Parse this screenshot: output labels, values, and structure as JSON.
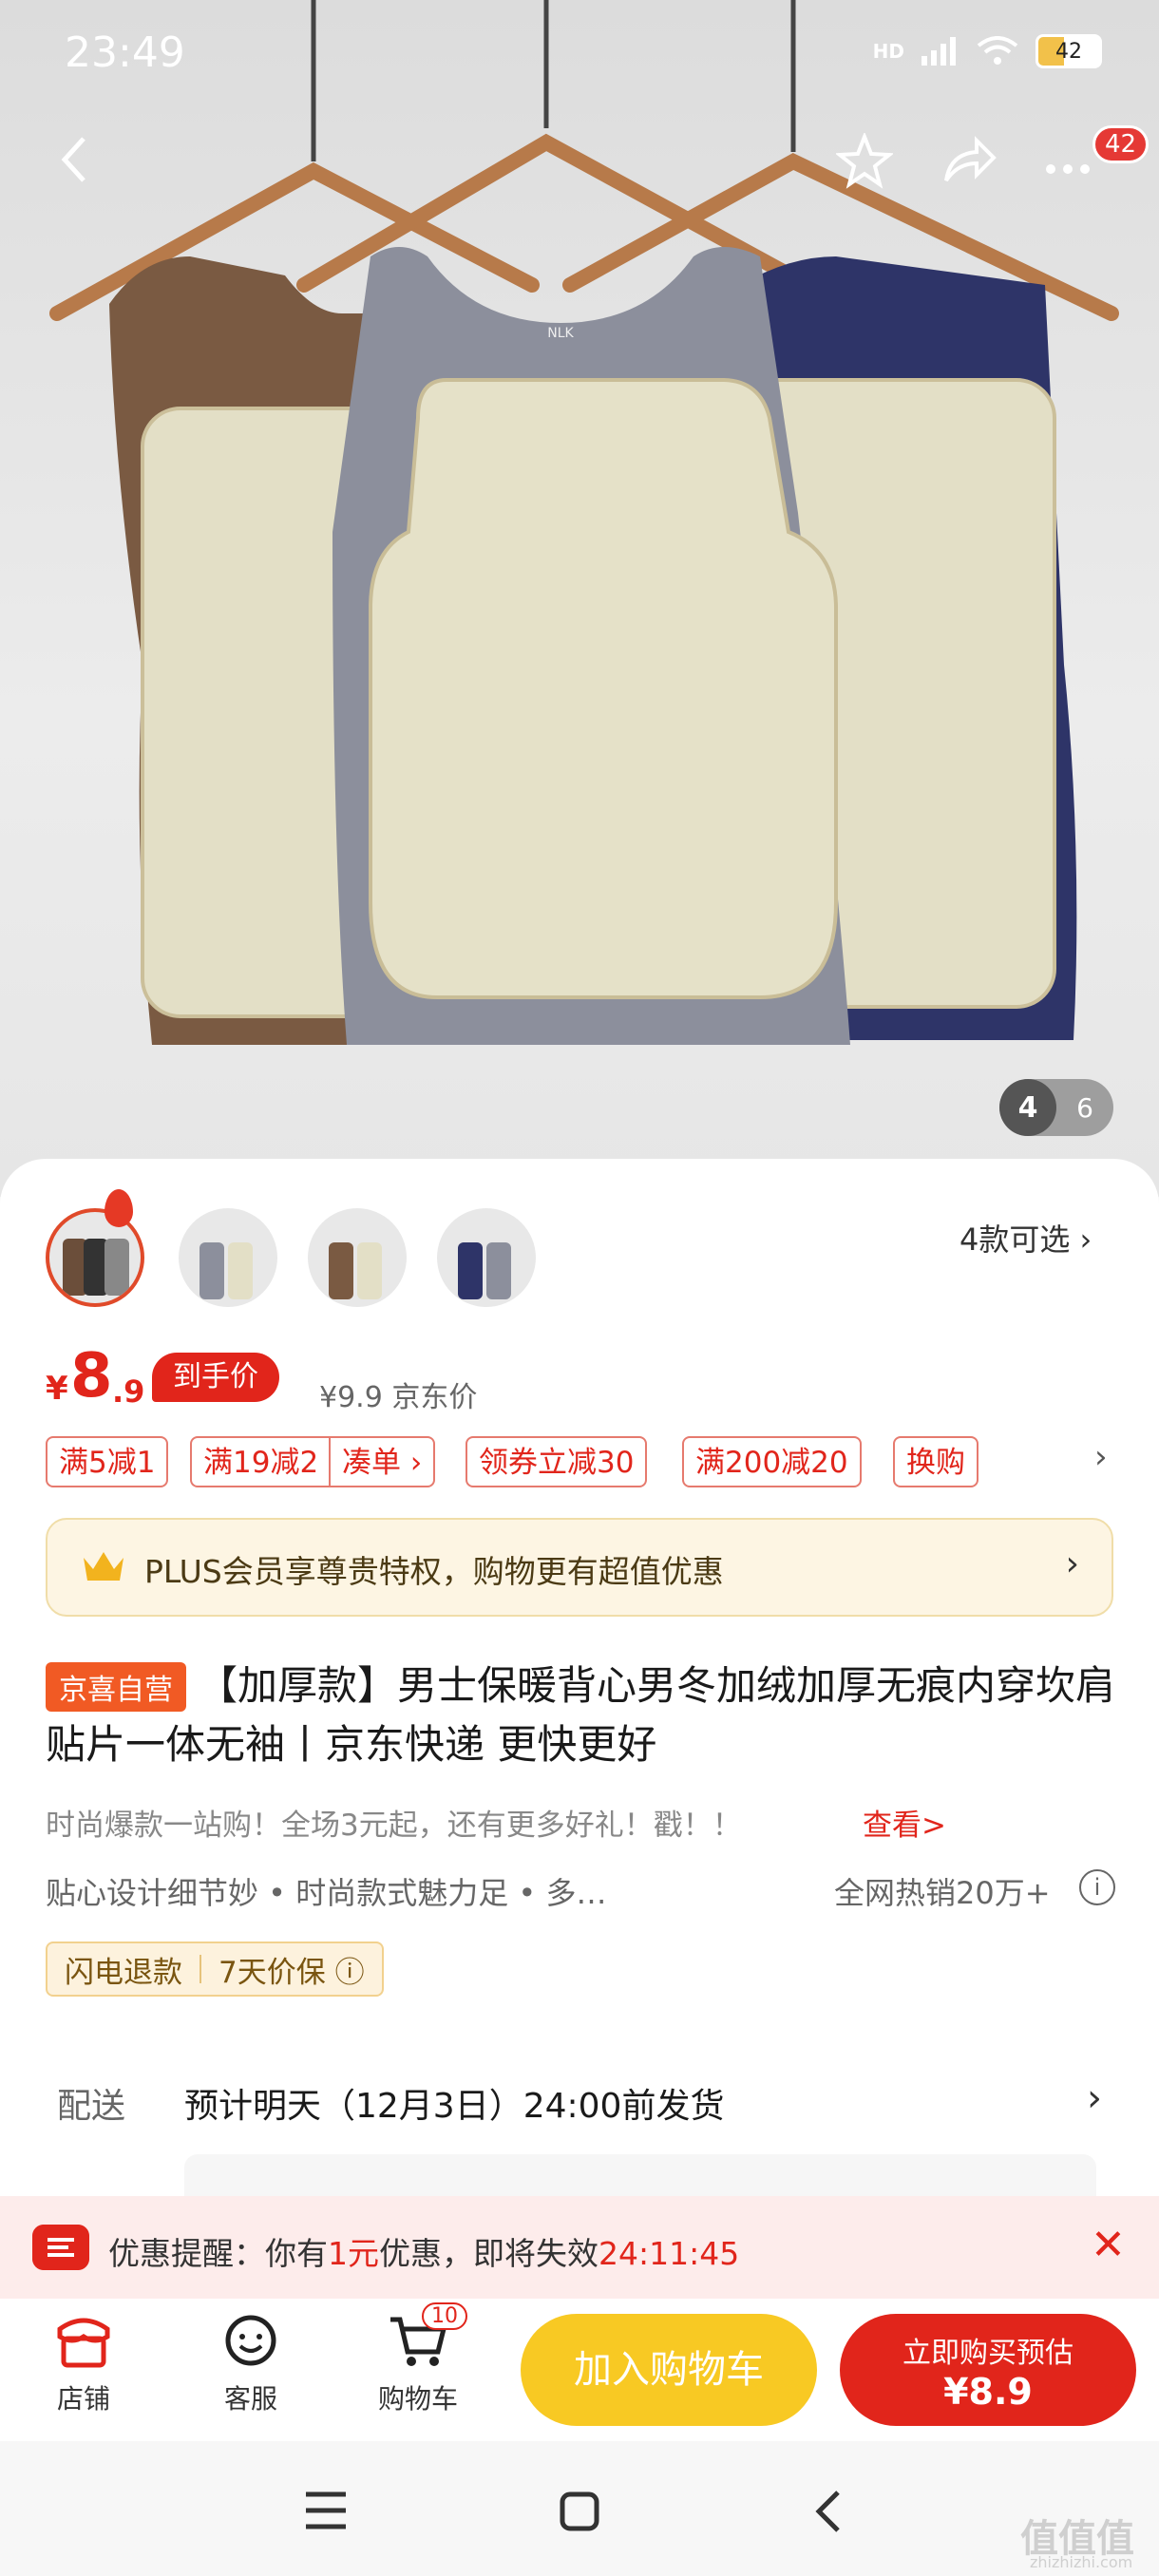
{
  "status": {
    "time": "23:49",
    "network": "HD",
    "battery": "42"
  },
  "top_nav": {
    "more_badge": "42"
  },
  "gallery": {
    "current": "4",
    "total": "6"
  },
  "variants": {
    "label": "4款可选 ›"
  },
  "price": {
    "symbol": "¥",
    "integer": "8",
    "decimal": ".9",
    "tag": "到手价",
    "original": "¥9.9  京东价"
  },
  "coupons": [
    "满5减1",
    "满19减2",
    "凑单 ›",
    "领券立减30",
    "满200减20",
    "换购"
  ],
  "plus": {
    "text": "PLUS会员享尊贵特权，购物更有超值优惠",
    "arrow": "›"
  },
  "product": {
    "badge": "京喜自营",
    "title": "【加厚款】男士保暖背心男冬加绒加厚无痕内穿坎肩贴片一体无袖丨京东快递 更快更好",
    "promo": "时尚爆款一站购！全场3元起，还有更多好礼！戳！！",
    "promo_link": "查看>",
    "features": "贴心设计细节妙  •  时尚款式魅力足  •  多…",
    "sales": "全网热销20万+",
    "guarantees": [
      "闪电退款",
      "7天价保 ⓘ"
    ]
  },
  "delivery": {
    "label": "配送",
    "text": "预计明天（12月3日）24:00前发货",
    "arrow": "›"
  },
  "reminder": {
    "text_prefix": "优惠提醒：你有",
    "amount": "1元",
    "text_mid": "优惠，即将失效",
    "countdown": "24:11:45",
    "close": "✕"
  },
  "bottom": {
    "shop": "店铺",
    "service": "客服",
    "cart": "购物车",
    "cart_count": "10",
    "add_to_cart": "加入购物车",
    "buy_now": "立即购买预估",
    "buy_price": "¥8.9"
  },
  "icons": {
    "back": "back-arrow-icon",
    "favorite": "star-icon",
    "share": "share-icon",
    "more": "more-icon"
  },
  "colors": {
    "accent": "#e1251b",
    "cart_yellow": "#f8c923",
    "plus_bg": "#fdf5e3"
  },
  "watermark": {
    "main": "值值值",
    "sub": "zhizhizhi.com"
  }
}
